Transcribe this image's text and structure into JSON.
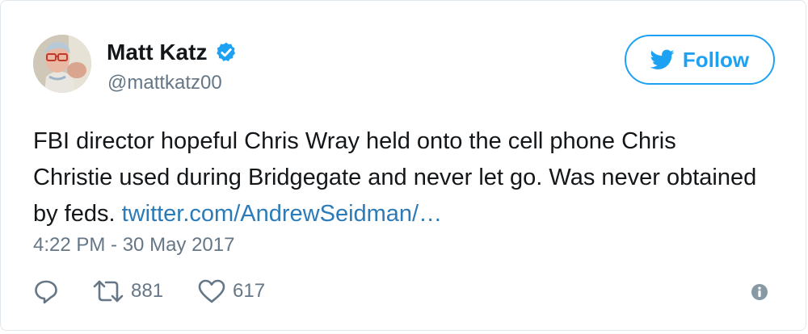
{
  "tweet": {
    "author_name": "Matt Katz",
    "handle": "@mattkatz00",
    "text_before_link": "FBI director hopeful Chris Wray held onto the cell phone Chris Christie used during Bridgegate and never let go. Was never obtained by feds. ",
    "link_text": "twitter.com/AndrewSeidman/…",
    "timestamp": "4:22 PM - 30 May 2017",
    "retweet_count": "881",
    "like_count": "617"
  },
  "follow_button": {
    "label": "Follow"
  },
  "icons": {
    "verified": "verified-badge-icon",
    "follow_bird": "twitter-bird-icon",
    "reply": "reply-icon",
    "retweet": "retweet-icon",
    "like": "heart-icon",
    "info": "info-icon"
  },
  "colors": {
    "accent": "#1da1f2",
    "link": "#2b7bb9",
    "text_primary": "#14171a",
    "text_secondary": "#657786",
    "border": "#e1e8ed"
  }
}
